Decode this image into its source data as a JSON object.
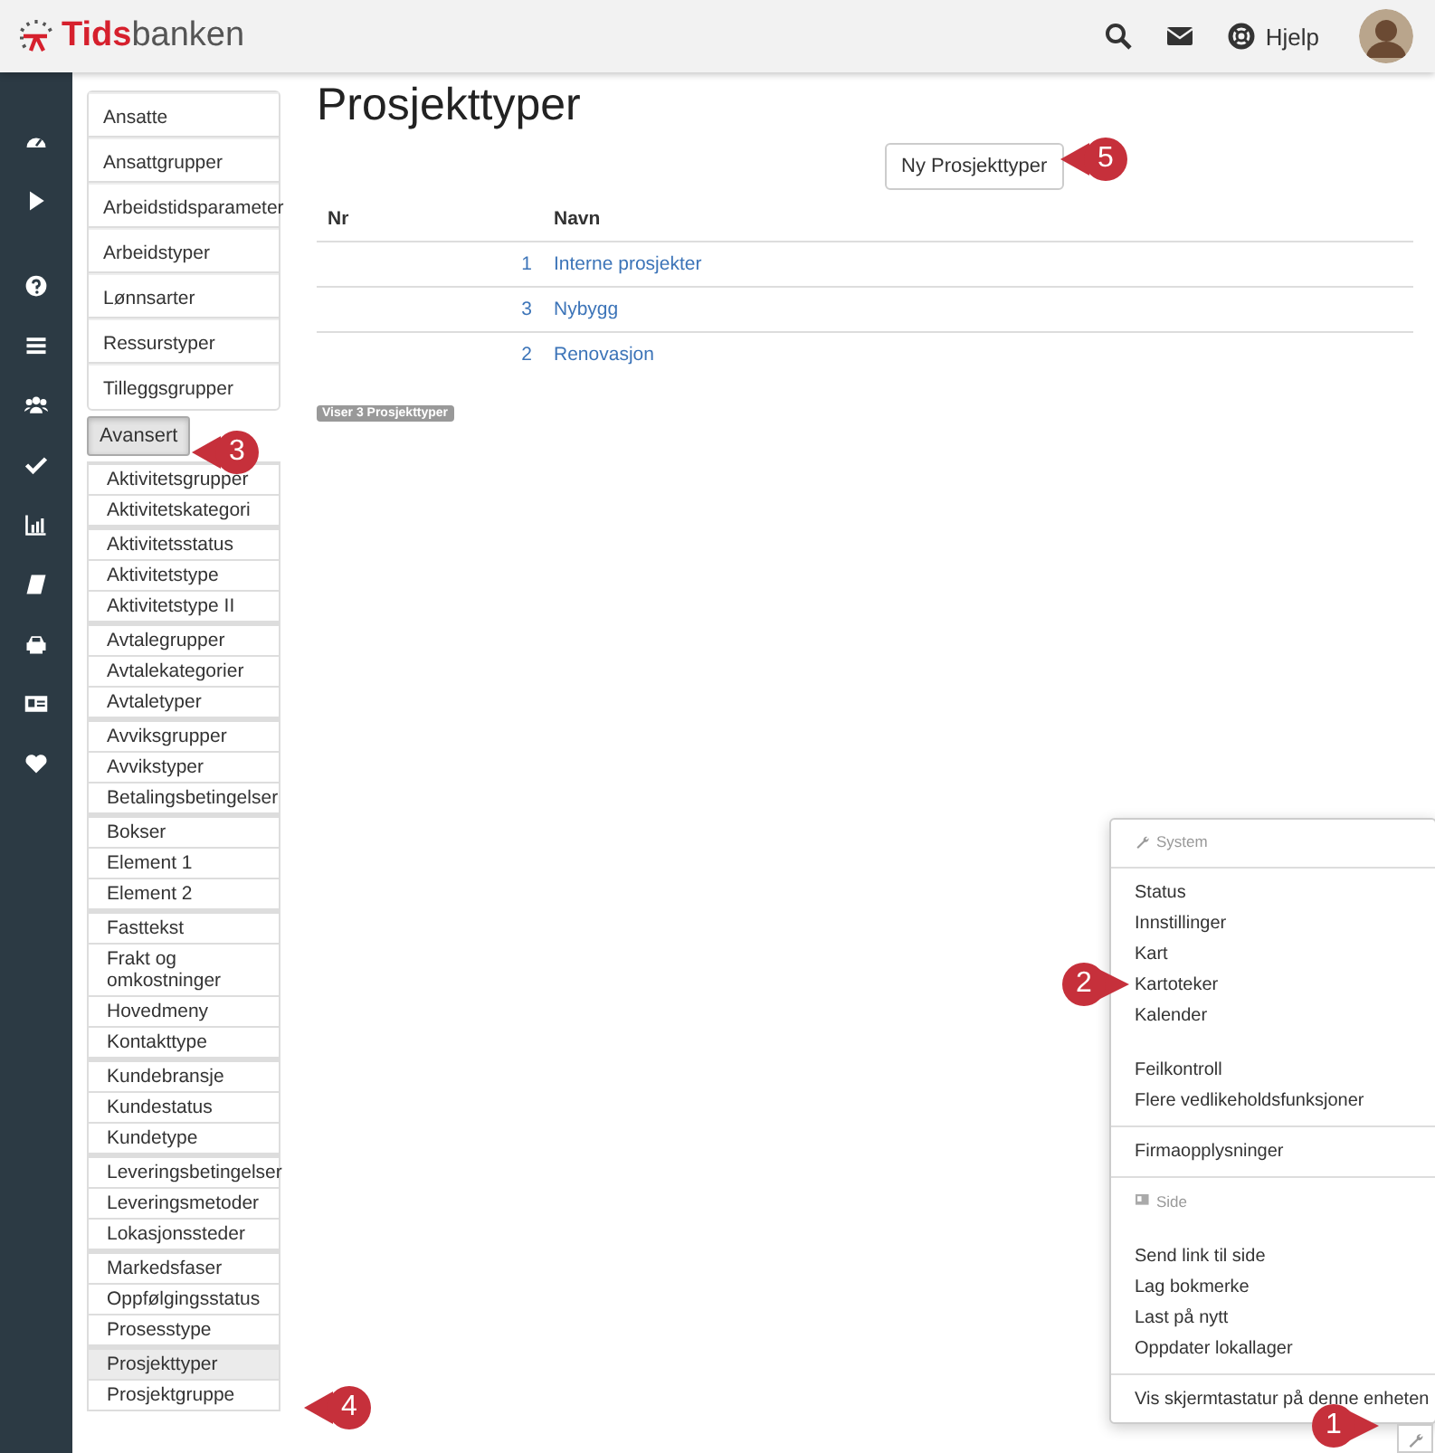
{
  "header": {
    "logo_bold": "Tids",
    "logo_rest": "banken",
    "help": "Hjelp"
  },
  "catalog": {
    "basic": [
      {
        "label": "Ansatte",
        "selected": false
      },
      {
        "label": "Ansattgrupper",
        "selected": false
      },
      {
        "label": "Arbeidstidsparameter",
        "selected": false
      },
      {
        "label": "Arbeidstyper",
        "selected": false
      },
      {
        "label": "Lønnsarter",
        "selected": false
      },
      {
        "label": "Ressurstyper",
        "selected": false
      },
      {
        "label": "Tilleggsgrupper",
        "selected": false
      }
    ],
    "advanced_button": {
      "label": "Avansert",
      "expanded": true
    },
    "advanced_groups": [
      {
        "items": [
          {
            "label": "Aktivitetsgrupper",
            "selected": false
          },
          {
            "label": "Aktivitetskategori",
            "selected": false
          }
        ]
      },
      {
        "items": [
          {
            "label": "Aktivitetsstatus",
            "selected": false
          },
          {
            "label": "Aktivitetstype",
            "selected": false
          },
          {
            "label": "Aktivitetstype II",
            "selected": false
          }
        ]
      },
      {
        "items": [
          {
            "label": "Avtalegrupper",
            "selected": false
          },
          {
            "label": "Avtalekategorier",
            "selected": false
          },
          {
            "label": "Avtaletyper",
            "selected": false
          }
        ]
      },
      {
        "items": [
          {
            "label": "Avviksgrupper",
            "selected": false
          },
          {
            "label": "Avvikstyper",
            "selected": false
          },
          {
            "label": "Betalingsbetingelser",
            "selected": false
          }
        ]
      },
      {
        "items": [
          {
            "label": "Bokser",
            "selected": false
          },
          {
            "label": "Element 1",
            "selected": false
          },
          {
            "label": "Element 2",
            "selected": false
          }
        ]
      },
      {
        "items": [
          {
            "label": "Fasttekst",
            "selected": false
          },
          {
            "label": "Frakt og omkostninger",
            "selected": false
          },
          {
            "label": "Hovedmeny",
            "selected": false
          },
          {
            "label": "Kontakttype",
            "selected": false
          }
        ]
      },
      {
        "items": [
          {
            "label": "Kundebransje",
            "selected": false
          },
          {
            "label": "Kundestatus",
            "selected": false
          },
          {
            "label": "Kundetype",
            "selected": false
          }
        ]
      },
      {
        "items": [
          {
            "label": "Leveringsbetingelser",
            "selected": false
          },
          {
            "label": "Leveringsmetoder",
            "selected": false
          },
          {
            "label": "Lokasjonssteder",
            "selected": false
          }
        ]
      },
      {
        "items": [
          {
            "label": "Markedsfaser",
            "selected": false
          },
          {
            "label": "Oppfølgingsstatus",
            "selected": false
          },
          {
            "label": "Prosesstype",
            "selected": false
          }
        ]
      },
      {
        "items": [
          {
            "label": "Prosjekttyper",
            "selected": true
          },
          {
            "label": "Prosjektgruppe",
            "selected": false
          }
        ]
      }
    ]
  },
  "page": {
    "title": "Prosjekttyper",
    "new_button": "Ny Prosjekttyper",
    "table": {
      "columns": [
        "Nr",
        "Navn"
      ],
      "rows": [
        {
          "nr": "1",
          "name": "Interne prosjekter"
        },
        {
          "nr": "3",
          "name": "Nybygg"
        },
        {
          "nr": "2",
          "name": "Renovasjon"
        }
      ]
    },
    "count_badge": "Viser 3 Prosjekttyper"
  },
  "system_menu": {
    "items": [
      {
        "kind": "heading",
        "label": "System"
      },
      {
        "kind": "divider"
      },
      {
        "kind": "item",
        "label": "Status"
      },
      {
        "kind": "item",
        "label": "Innstillinger"
      },
      {
        "kind": "item",
        "label": "Kart"
      },
      {
        "kind": "item",
        "label": "Kartoteker"
      },
      {
        "kind": "item",
        "label": "Kalender"
      },
      {
        "kind": "spacer"
      },
      {
        "kind": "item",
        "label": "Feilkontroll"
      },
      {
        "kind": "item",
        "label": "Flere vedlikeholdsfunksjoner"
      },
      {
        "kind": "divider"
      },
      {
        "kind": "item",
        "label": "Firmaopplysninger"
      },
      {
        "kind": "divider"
      },
      {
        "kind": "heading",
        "label": "Side"
      },
      {
        "kind": "spacer"
      },
      {
        "kind": "item",
        "label": "Send link til side"
      },
      {
        "kind": "item",
        "label": "Lag bokmerke"
      },
      {
        "kind": "item",
        "label": "Last på nytt"
      },
      {
        "kind": "item",
        "label": "Oppdater lokallager"
      },
      {
        "kind": "divider"
      },
      {
        "kind": "item",
        "label": "Vis skjermtastatur på denne enheten"
      }
    ]
  },
  "callouts": [
    {
      "number": "1"
    },
    {
      "number": "2"
    },
    {
      "number": "3"
    },
    {
      "number": "4"
    },
    {
      "number": "5"
    }
  ]
}
